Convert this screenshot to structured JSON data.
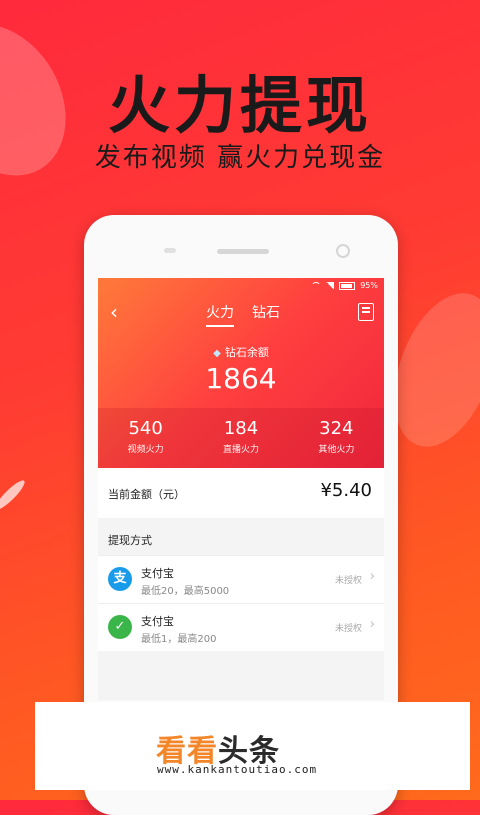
{
  "headline": "火力提现",
  "subline": "发布视频 赢火力兑现金",
  "status": {
    "battery": "95%"
  },
  "nav": {
    "back": "‹",
    "tabs": [
      {
        "label": "火力"
      },
      {
        "label": "钻石"
      }
    ]
  },
  "balance": {
    "label": "钻石余额",
    "value": "1864"
  },
  "stats": [
    {
      "value": "540",
      "label": "视频火力"
    },
    {
      "value": "184",
      "label": "直播火力"
    },
    {
      "value": "324",
      "label": "其他火力"
    }
  ],
  "amount": {
    "label": "当前金额（元）",
    "value": "¥5.40"
  },
  "withdraw": {
    "title": "提现方式",
    "methods": [
      {
        "icon": "alipay-icon",
        "glyph": "支",
        "name": "支付宝",
        "limit": "最低20，最高5000",
        "status": "未授权",
        "color": "#1a9bea"
      },
      {
        "icon": "wechat-icon",
        "glyph": "✓",
        "name": "支付宝",
        "limit": "最低1，最高200",
        "status": "未授权",
        "color": "#3ab54a"
      }
    ]
  },
  "watermark": {
    "name_a": "看看",
    "name_b": "头条",
    "url": "www.kankantoutiao.com"
  },
  "colors": {
    "accent": "#ff3b33",
    "alipay": "#1a9bea",
    "wechat": "#3ab54a",
    "logo_orange": "#f4862a"
  }
}
